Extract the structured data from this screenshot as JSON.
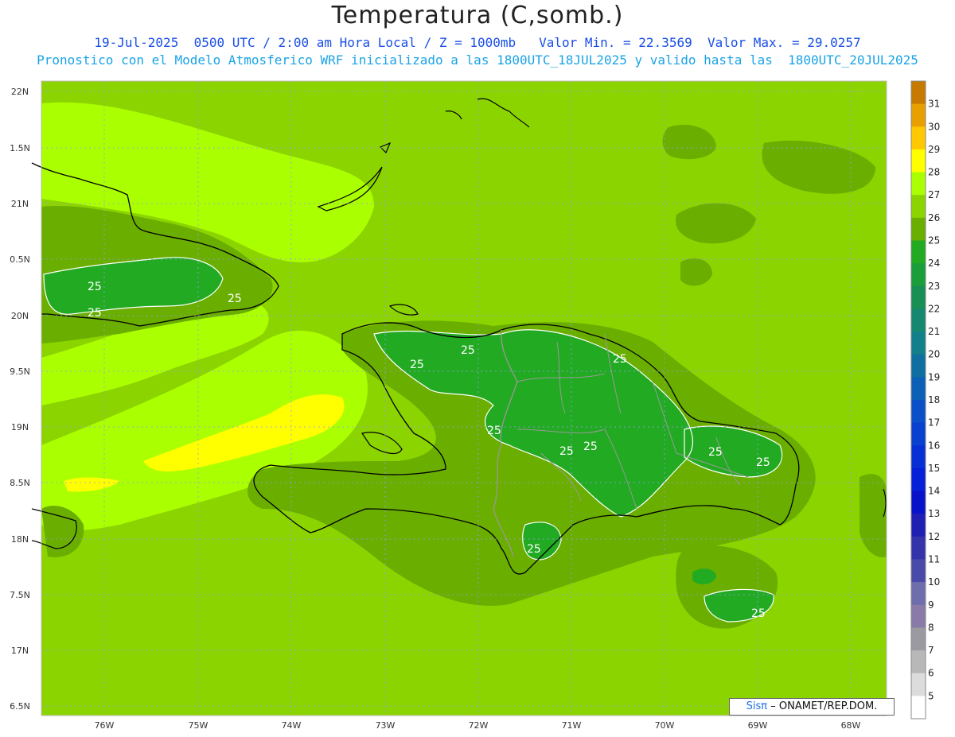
{
  "header": {
    "title": "Temperatura (C,somb.)",
    "line1": "19-Jul-2025  0500 UTC / 2:00 am Hora Local / Z = 1000mb   Valor Min. = 22.3569  Valor Max. = 29.0257",
    "line2": "Pronostico con el Modelo Atmosferico WRF inicializado a las 1800UTC_18JUL2025 y valido hasta las  1800UTC_20JUL2025"
  },
  "axes": {
    "lat_labels": [
      "22N",
      "1.5N",
      "21N",
      "0.5N",
      "20N",
      "9.5N",
      "19N",
      "8.5N",
      "18N",
      "7.5N",
      "17N",
      "6.5N"
    ],
    "lon_labels": [
      "76W",
      "75W",
      "74W",
      "73W",
      "72W",
      "71W",
      "70W",
      "69W",
      "68W"
    ]
  },
  "contour_labels": [
    "25",
    "25",
    "25",
    "25",
    "25",
    "25",
    "25",
    "25",
    "25",
    "25",
    "25",
    "25",
    "25"
  ],
  "colorbar": {
    "labels": [
      "31",
      "30",
      "29",
      "28",
      "27",
      "26",
      "25",
      "24",
      "23",
      "22",
      "21",
      "20",
      "19",
      "18",
      "17",
      "16",
      "15",
      "14",
      "13",
      "12",
      "11",
      "10",
      "9",
      "8",
      "7",
      "6",
      "5"
    ],
    "colors": [
      "#c77a00",
      "#e8a000",
      "#ffc800",
      "#ffff00",
      "#aaff00",
      "#8cd400",
      "#6aae00",
      "#22aa22",
      "#1a9e3a",
      "#178f55",
      "#168870",
      "#12808a",
      "#0f6fa0",
      "#0c60b5",
      "#0a50c8",
      "#0840d0",
      "#0630d6",
      "#0420d8",
      "#0812c8",
      "#1f1fb4",
      "#3333aa",
      "#4a4aa8",
      "#6e6eae",
      "#8a7aa8",
      "#9a9aa0",
      "#b8b8b8",
      "#dcdcdc",
      "#ffffff"
    ]
  },
  "credit": {
    "sis": "Sisπ",
    "rest": "– ONAMET/REP.DOM."
  }
}
